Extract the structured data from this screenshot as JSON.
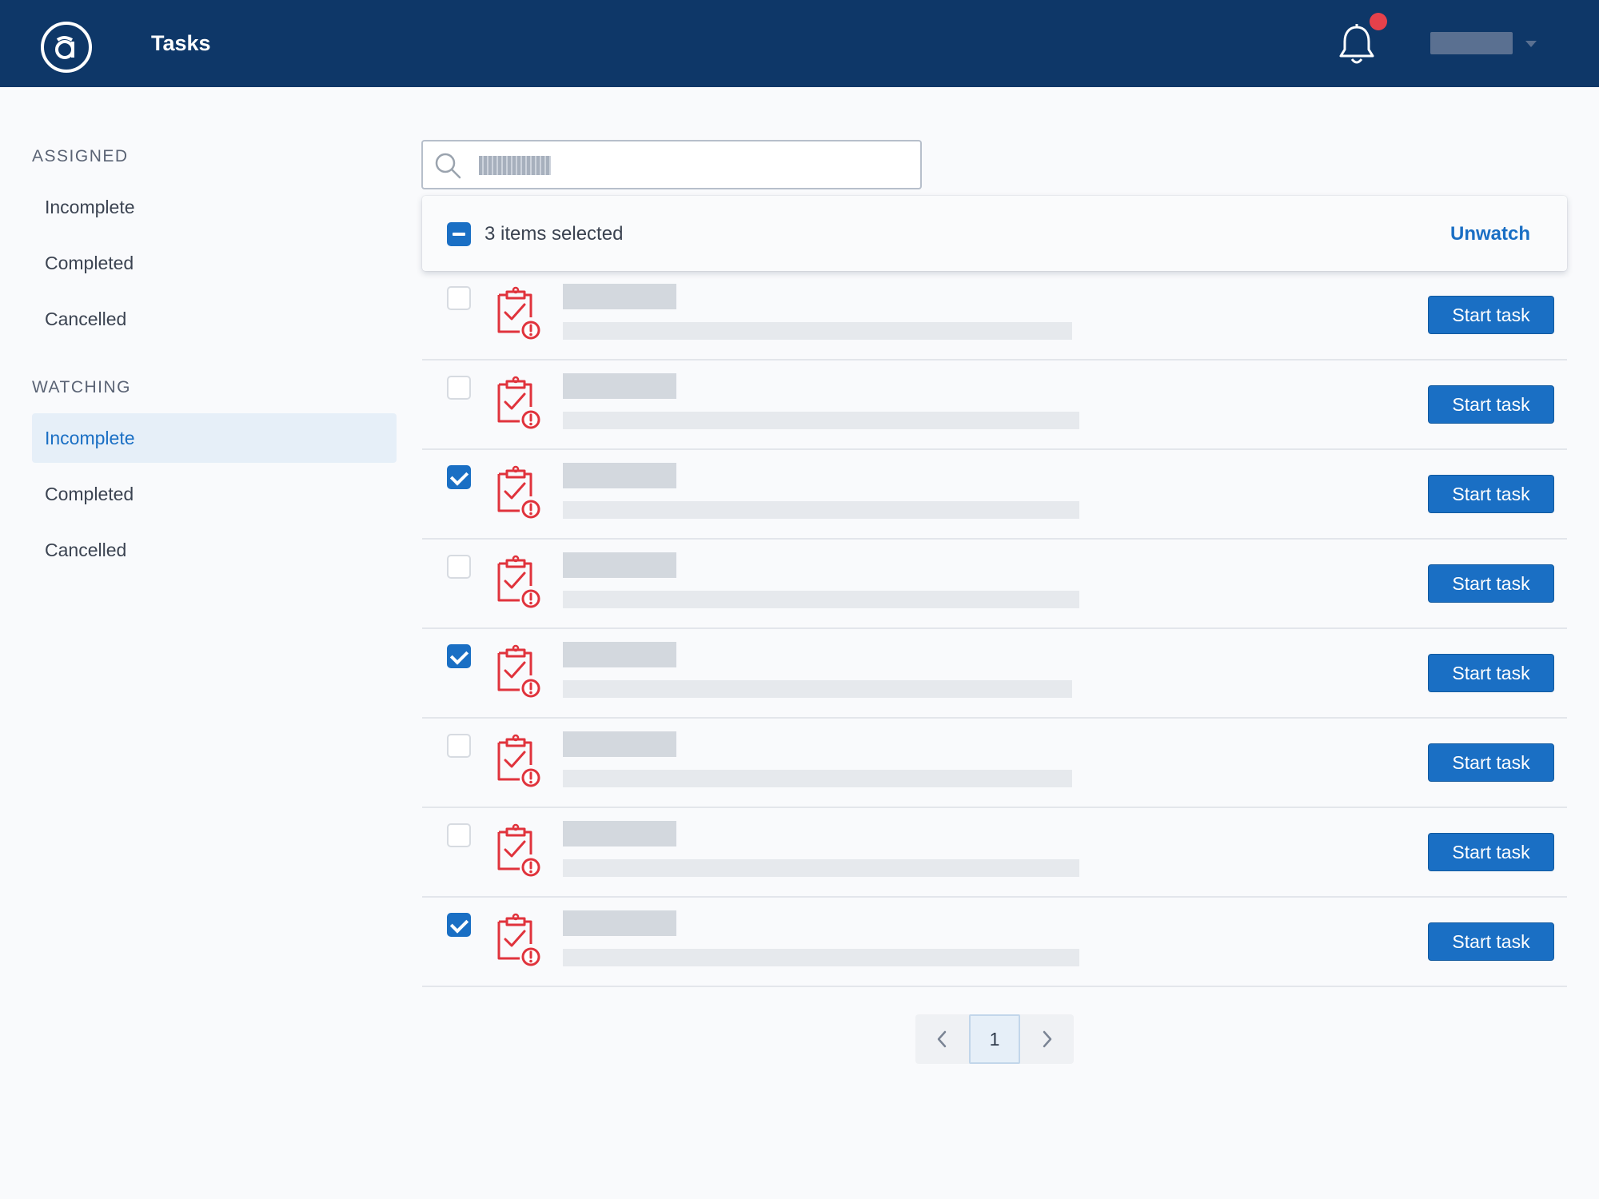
{
  "header": {
    "logo_icon": "at-sign-logo",
    "title": "Tasks",
    "notifications_icon": "bell-icon",
    "has_unread_notifications": true,
    "user_menu_icon": "chevron-down-icon"
  },
  "sidebar": {
    "sections": [
      {
        "heading": "ASSIGNED",
        "items": [
          {
            "label": "Incomplete",
            "active": false
          },
          {
            "label": "Completed",
            "active": false
          },
          {
            "label": "Cancelled",
            "active": false
          }
        ]
      },
      {
        "heading": "WATCHING",
        "items": [
          {
            "label": "Incomplete",
            "active": true
          },
          {
            "label": "Completed",
            "active": false
          },
          {
            "label": "Cancelled",
            "active": false
          }
        ]
      }
    ]
  },
  "search": {
    "icon": "search-icon"
  },
  "selection_bar": {
    "text": "3 items selected",
    "action_label": "Unwatch"
  },
  "tasks": [
    {
      "checked": false,
      "start_label": "Start task"
    },
    {
      "checked": false,
      "start_label": "Start task"
    },
    {
      "checked": true,
      "start_label": "Start task"
    },
    {
      "checked": false,
      "start_label": "Start task"
    },
    {
      "checked": true,
      "start_label": "Start task"
    },
    {
      "checked": false,
      "start_label": "Start task"
    },
    {
      "checked": false,
      "start_label": "Start task"
    },
    {
      "checked": true,
      "start_label": "Start task"
    }
  ],
  "task_icon": "clipboard-alert-icon",
  "pagination": {
    "current_page": "1",
    "prev_icon": "chevron-left-icon",
    "next_icon": "chevron-right-icon"
  },
  "colors": {
    "header_bg": "#0e3768",
    "accent": "#1a6fc4",
    "alert": "#e5414b",
    "task_icon": "#e0333c"
  }
}
